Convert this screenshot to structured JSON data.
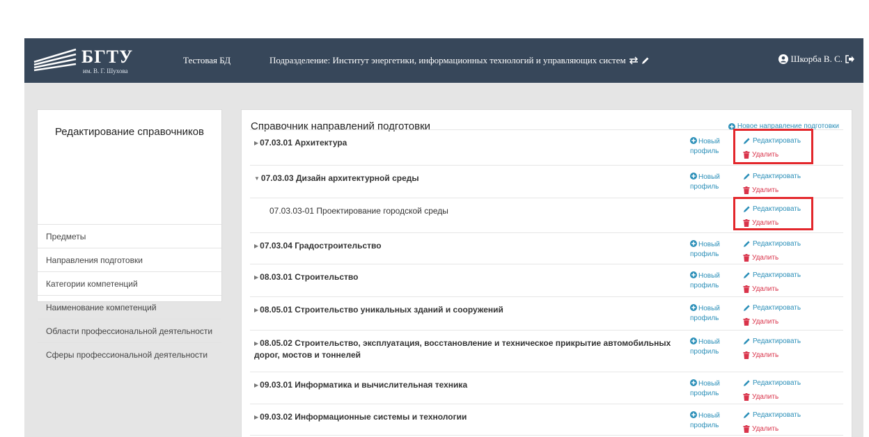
{
  "header": {
    "logo_title": "БГТУ",
    "logo_sub": "им. В. Г. Шухова",
    "db_name": "Тестовая БД",
    "division": "Подразделение: Институт энергетики, информационных технологий и управляющих систем",
    "user": "Шкорба В. С."
  },
  "sidebar": {
    "title": "Редактирование справочников",
    "items": [
      {
        "label": "Предметы"
      },
      {
        "label": "Направления подготовки"
      },
      {
        "label": "Категории компетенций"
      },
      {
        "label": "Наименование компетенций"
      },
      {
        "label": "Области профессиональной деятельности"
      },
      {
        "label": "Сферы профессиональной деятельности"
      }
    ]
  },
  "main": {
    "title": "Справочник направлений подготовки",
    "new_direction": "Новое направление подготовки",
    "new_profile": "Новый профиль",
    "edit": "Редактировать",
    "delete": "Удалить",
    "rows": [
      {
        "label": "07.03.01 Архитектура",
        "type": "collapsed"
      },
      {
        "label": "07.03.03 Дизайн архитектурной среды",
        "type": "expanded"
      },
      {
        "label": "07.03.03-01 Проектирование городской среды",
        "type": "profile"
      },
      {
        "label": "07.03.04 Градостроительство",
        "type": "collapsed"
      },
      {
        "label": "08.03.01 Строительство",
        "type": "collapsed"
      },
      {
        "label": "08.05.01 Строительство уникальных зданий и сооружений",
        "type": "collapsed"
      },
      {
        "label": "08.05.02 Строительство, эксплуатация, восстановление и техническое прикрытие автомобильных дорог, мостов и тоннелей",
        "type": "collapsed"
      },
      {
        "label": "09.03.01 Информатика и вычислительная техника",
        "type": "collapsed"
      },
      {
        "label": "09.03.02 Информационные системы и технологии",
        "type": "collapsed"
      }
    ]
  },
  "colors": {
    "header_bg": "#37475a",
    "link": "#2b8fb8",
    "danger": "#d9334a",
    "highlight": "#e3262b"
  }
}
